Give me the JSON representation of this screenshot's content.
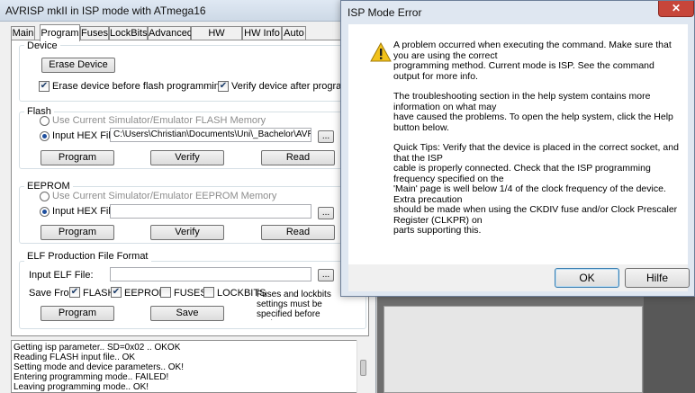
{
  "main_window": {
    "title": "AVRISP mkII in ISP mode with ATmega16",
    "tabs": [
      {
        "label": "Main"
      },
      {
        "label": "Program"
      },
      {
        "label": "Fuses"
      },
      {
        "label": "LockBits"
      },
      {
        "label": "Advanced"
      },
      {
        "label": "HW Settings"
      },
      {
        "label": "HW Info"
      },
      {
        "label": "Auto"
      }
    ],
    "active_tab": "Program",
    "device": {
      "title": "Device",
      "erase_button": "Erase Device",
      "erase_before_label": "Erase device before flash programming",
      "erase_before_checked": true,
      "verify_after_label": "Verify device after programming",
      "verify_after_checked": true
    },
    "flash": {
      "title": "Flash",
      "use_simulator_label": "Use Current Simulator/Emulator FLASH Memory",
      "input_hex_label": "Input HEX File",
      "hex_path": "C:\\Users\\Christian\\Documents\\Uni\\_Bachelor\\AVR Proje",
      "browse_label": "...",
      "program_label": "Program",
      "verify_label": "Verify",
      "read_label": "Read"
    },
    "eeprom": {
      "title": "EEPROM",
      "use_simulator_label": "Use Current Simulator/Emulator EEPROM Memory",
      "input_hex_label": "Input HEX File",
      "hex_path": "",
      "browse_label": "...",
      "program_label": "Program",
      "verify_label": "Verify",
      "read_label": "Read"
    },
    "elf": {
      "title": "ELF Production File Format",
      "input_label": "Input ELF File:",
      "input_value": "",
      "browse_label": "...",
      "save_from_label": "Save From:",
      "flash_label": "FLASH",
      "flash_checked": true,
      "eeprom_label": "EEPROM",
      "eeprom_checked": true,
      "fuses_label": "FUSES",
      "fuses_checked": false,
      "lockbits_label": "LOCKBITS",
      "lockbits_checked": false,
      "note": "Fuses and lockbits settings must be specified before saving to ELF",
      "program_label": "Program",
      "save_label": "Save"
    },
    "log": [
      "Getting isp parameter.. SD=0x02 .. OKOK",
      "Reading FLASH input file.. OK",
      "Setting mode and device parameters.. OK!",
      "Entering programming mode.. FAILED!",
      "Leaving programming mode.. OK!"
    ]
  },
  "dialog": {
    "title": "ISP Mode Error",
    "close_glyph": "✕",
    "icon": "warning-icon",
    "paragraphs": [
      "A problem occurred when executing the command. Make sure that you are using the correct\nprogramming method. Current mode is ISP. See the command output for more info.",
      "The troubleshooting section in the help system contains more information on what may\nhave caused the problems. To open the help system, click the Help button below.",
      "Quick Tips: Verify that the device is placed in the correct socket, and that the ISP\ncable is properly connected. Check that the ISP programming frequency specified on the\n'Main' page is well below 1/4 of the clock frequency of the device. Extra precaution\nshould be made when using the CKDIV fuse and/or Clock Prescaler Register (CLKPR) on\nparts supporting this."
    ],
    "ok_label": "OK",
    "help_label": "Hilfe"
  }
}
